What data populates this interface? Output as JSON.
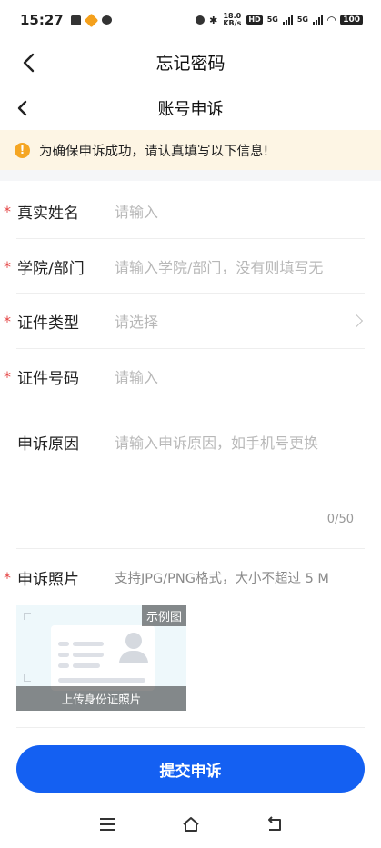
{
  "status_bar": {
    "time": "15:27",
    "net_speed": "18.0 KB/s",
    "hd_tag": "HD",
    "net1": "5G",
    "net2": "5G",
    "battery": "100"
  },
  "nav": {
    "title": "忘记密码",
    "back_icon": "chevron-left-icon"
  },
  "sub_nav": {
    "title": "账号申诉",
    "back_icon": "chevron-left-icon"
  },
  "notice": {
    "icon": "exclamation-icon",
    "icon_glyph": "!",
    "text": "为确保申诉成功，请认真填写以下信息!"
  },
  "form": {
    "required_mark": "*",
    "fields": [
      {
        "label": "真实姓名",
        "placeholder": "请输入",
        "required": true
      },
      {
        "label": "学院/部门",
        "placeholder": "请输入学院/部门，没有则填写无",
        "required": true
      },
      {
        "label": "证件类型",
        "placeholder": "请选择",
        "required": true
      },
      {
        "label": "证件号码",
        "placeholder": "请输入",
        "required": true
      },
      {
        "label": "申诉原因",
        "placeholder": "请输入申诉原因，如手机号更换",
        "required": false
      }
    ],
    "reason_counter": "0/50",
    "photo": {
      "label": "申诉照片",
      "hint": "支持JPG/PNG格式，大小不超过 5 M",
      "sample_badge": "示例图",
      "upload_caption": "上传身份证照片"
    }
  },
  "submit_label": "提交申诉",
  "colors": {
    "primary": "#1460f2",
    "required": "#e54545",
    "notice_bg": "#fdf5e4",
    "notice_icon": "#f5a623"
  }
}
